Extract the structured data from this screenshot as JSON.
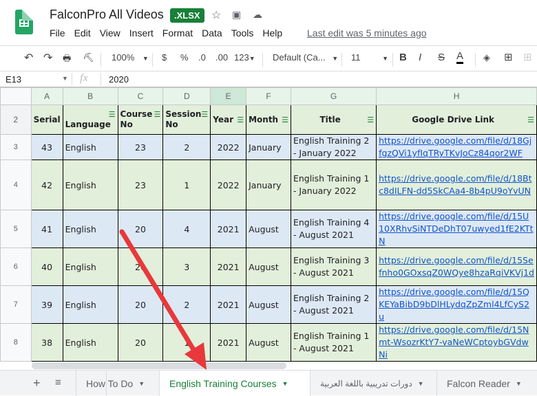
{
  "app": {
    "title": "FalconPro All Videos",
    "badge": ".XLSX",
    "last_edit": "Last edit was 5 minutes ago"
  },
  "menu": [
    "File",
    "Edit",
    "View",
    "Insert",
    "Format",
    "Data",
    "Tools",
    "Help"
  ],
  "toolbar": {
    "zoom": "100%",
    "currency": "$",
    "percent": "%",
    "dec_less": ".0",
    "dec_more": ".00",
    "format": "123",
    "font": "Default (Ca...",
    "size": "11",
    "bold": "B",
    "italic": "I",
    "strike": "S",
    "text_color": "A"
  },
  "formula_bar": {
    "cell_ref": "E13",
    "fx": "fx",
    "value": "2020"
  },
  "columns": [
    "A",
    "B",
    "C",
    "D",
    "E",
    "F",
    "G",
    "H"
  ],
  "header_row": {
    "num": "2",
    "cells": [
      "Serial",
      "Language",
      "Course No",
      "Session No",
      "Year",
      "Month",
      "Title",
      "Google Drive Link"
    ]
  },
  "rows": [
    {
      "num": "3",
      "serial": "43",
      "language": "English",
      "course": "23",
      "session": "2",
      "year": "2022",
      "month": "January",
      "title": "English Training 2 - January 2022",
      "link": "https://drive.google.com/file/d/18GjfgzQVi1yfIqTRyTKvJoCz84qor2WF"
    },
    {
      "num": "4",
      "serial": "42",
      "language": "English",
      "course": "23",
      "session": "1",
      "year": "2022",
      "month": "January",
      "title": "English Training 1 - January 2022",
      "link": "https://drive.google.com/file/d/18Btc8dILFN-dd5SkCAa4-8b4pU9oYvUN"
    },
    {
      "num": "5",
      "serial": "41",
      "language": "English",
      "course": "20",
      "session": "4",
      "year": "2021",
      "month": "August",
      "title": "English Training 4 - August 2021",
      "link": "https://drive.google.com/file/d/15U10XRhvSiNTDeDhT07uwyed1fE2KTtN"
    },
    {
      "num": "6",
      "serial": "40",
      "language": "English",
      "course": "20",
      "session": "3",
      "year": "2021",
      "month": "August",
      "title": "English Training 3 - August 2021",
      "link": "https://drive.google.com/file/d/15Sefnho0GOxsqZ0WQye8hzaRqiVKVj1d"
    },
    {
      "num": "7",
      "serial": "39",
      "language": "English",
      "course": "20",
      "session": "2",
      "year": "2021",
      "month": "August",
      "title": "English Training 2 - August 2021",
      "link": "https://drive.google.com/file/d/15QKEYaBibD9bDlHLydqZpZml4LfCyS2u"
    },
    {
      "num": "8",
      "serial": "38",
      "language": "English",
      "course": "20",
      "session": "1",
      "year": "2021",
      "month": "August",
      "title": "English Training 1 - August 2021",
      "link": "https://drive.google.com/file/d/15Nmt-WsozrKtY7-vaNeWCptoybGVdwNi"
    }
  ],
  "sheet_tabs": [
    "How To Do",
    "English Training Courses",
    "دورات تدريبية باللغة العربية",
    "Falcon Reader"
  ],
  "active_tab": "English Training Courses",
  "colors": {
    "accent": "#188038",
    "annotation_arrow": "#e8383b",
    "link": "#1155cc"
  }
}
